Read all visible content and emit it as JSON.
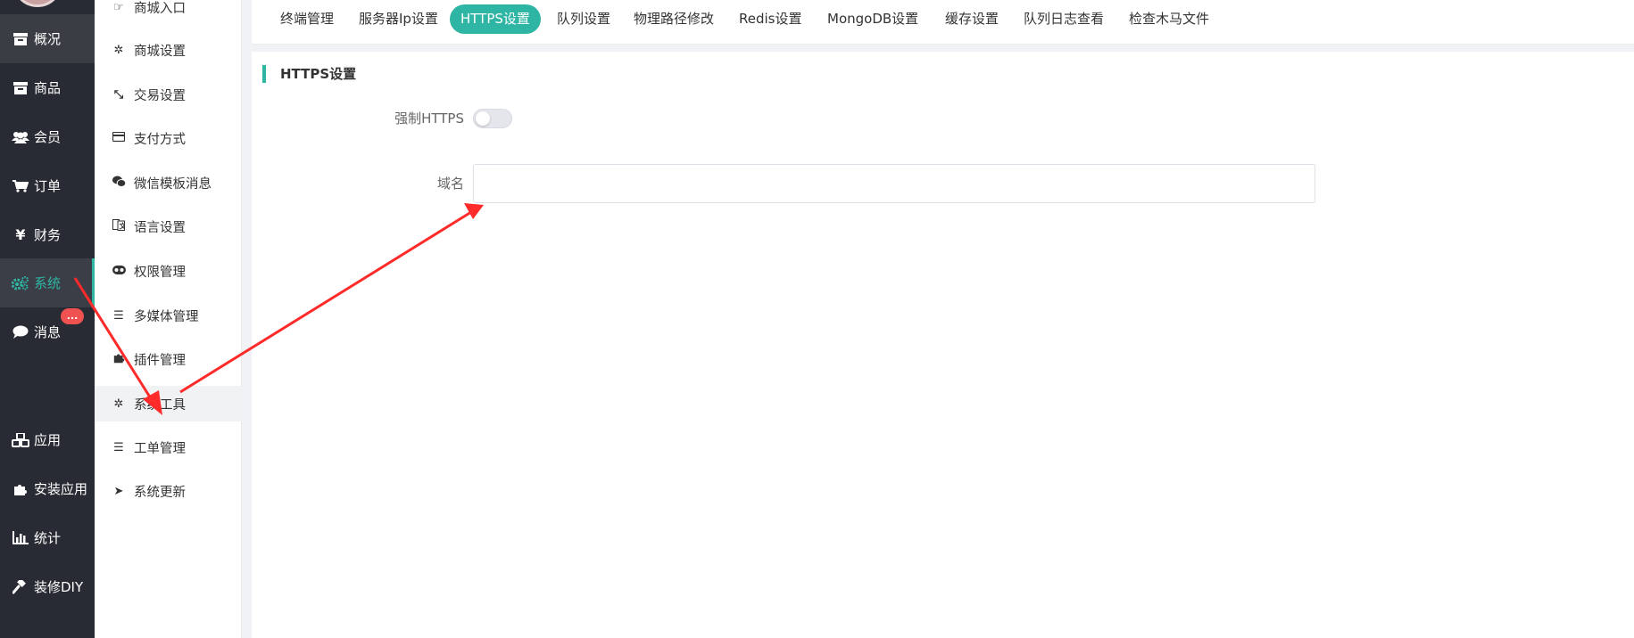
{
  "nav": {
    "items": [
      {
        "label": "概况",
        "icon": "archive-icon"
      },
      {
        "label": "商品",
        "icon": "box-icon"
      },
      {
        "label": "会员",
        "icon": "users-icon"
      },
      {
        "label": "订单",
        "icon": "cart-icon"
      },
      {
        "label": "财务",
        "icon": "yen-icon"
      },
      {
        "label": "系统",
        "icon": "gears-icon"
      },
      {
        "label": "消息",
        "icon": "chat-icon"
      },
      {
        "label": "应用",
        "icon": "cubes-icon"
      },
      {
        "label": "安装应用",
        "icon": "puzzle-icon"
      },
      {
        "label": "统计",
        "icon": "bar-chart-icon"
      },
      {
        "label": "装修DIY",
        "icon": "gavel-icon"
      }
    ],
    "message_badge": "...",
    "active_color": "#2fb5a4"
  },
  "subnav": {
    "items": [
      {
        "label": "商城入口",
        "icon": "hand-pointer-icon"
      },
      {
        "label": "商城设置",
        "icon": "gear-icon"
      },
      {
        "label": "交易设置",
        "icon": "compress-icon"
      },
      {
        "label": "支付方式",
        "icon": "credit-card-icon"
      },
      {
        "label": "微信模板消息",
        "icon": "wechat-icon"
      },
      {
        "label": "语言设置",
        "icon": "language-icon"
      },
      {
        "label": "权限管理",
        "icon": "gamepad-icon"
      },
      {
        "label": "多媒体管理",
        "icon": "list-icon"
      },
      {
        "label": "插件管理",
        "icon": "puzzle-icon"
      },
      {
        "label": "系统工具",
        "icon": "gear-icon"
      },
      {
        "label": "工单管理",
        "icon": "list-icon"
      },
      {
        "label": "系统更新",
        "icon": "send-icon"
      }
    ]
  },
  "tabs": [
    "终端管理",
    "服务器Ip设置",
    "HTTPS设置",
    "队列设置",
    "物理路径修改",
    "Redis设置",
    "MongoDB设置",
    "缓存设置",
    "队列日志查看",
    "检查木马文件"
  ],
  "active_tab": "HTTPS设置",
  "panel": {
    "section_title": "HTTPS设置",
    "force_https_label": "强制HTTPS",
    "force_https_enabled": false,
    "domain_label": "域名",
    "domain_value": ""
  },
  "annotation_color": "#ff2a2a"
}
